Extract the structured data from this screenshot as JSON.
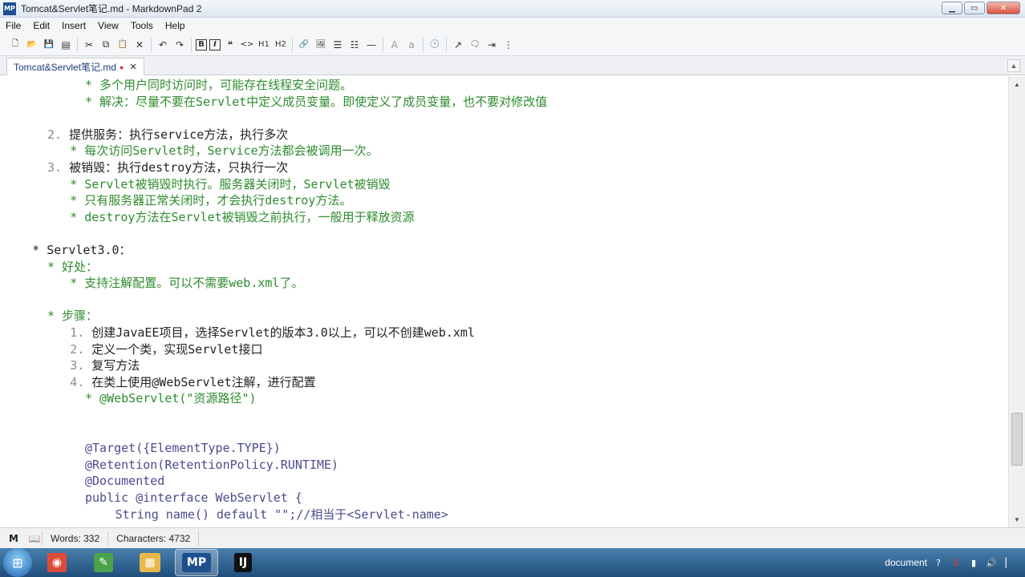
{
  "window": {
    "title": "Tomcat&Servlet笔记.md - MarkdownPad 2",
    "icon": "MP"
  },
  "window_controls": {
    "minimize": "▁",
    "maximize": "▭",
    "close": "✕"
  },
  "menu": [
    "File",
    "Edit",
    "Insert",
    "View",
    "Tools",
    "Help"
  ],
  "toolbar": {
    "icons": [
      {
        "name": "new-icon",
        "glyph": "🗋"
      },
      {
        "name": "open-icon",
        "glyph": "📂"
      },
      {
        "name": "save-icon",
        "glyph": "💾"
      },
      {
        "name": "save-all-icon",
        "glyph": "▤"
      },
      {
        "name": "cut-icon",
        "glyph": "✂"
      },
      {
        "name": "copy-icon",
        "glyph": "⧉"
      },
      {
        "name": "paste-icon",
        "glyph": "📋"
      },
      {
        "name": "delete-icon",
        "glyph": "✕"
      },
      {
        "name": "undo-icon",
        "glyph": "↶"
      },
      {
        "name": "redo-icon",
        "glyph": "↷"
      },
      {
        "name": "bold-icon",
        "glyph": "B"
      },
      {
        "name": "italic-icon",
        "glyph": "I"
      },
      {
        "name": "quote-icon",
        "glyph": "❝"
      },
      {
        "name": "code-icon",
        "glyph": "<>"
      },
      {
        "name": "h1-icon",
        "glyph": "H1"
      },
      {
        "name": "h2-icon",
        "glyph": "H2"
      },
      {
        "name": "link-icon",
        "glyph": "🔗"
      },
      {
        "name": "image-icon",
        "glyph": "🖼"
      },
      {
        "name": "unordered-list-icon",
        "glyph": "☰"
      },
      {
        "name": "ordered-list-icon",
        "glyph": "☷"
      },
      {
        "name": "horizontal-rule-icon",
        "glyph": "—"
      },
      {
        "name": "uppercase-icon",
        "glyph": "A"
      },
      {
        "name": "lowercase-icon",
        "glyph": "a"
      },
      {
        "name": "timestamp-icon",
        "glyph": "🕒"
      },
      {
        "name": "preview-icon",
        "glyph": "↗"
      },
      {
        "name": "preview-side-icon",
        "glyph": "🗨"
      },
      {
        "name": "export-icon",
        "glyph": "⇥"
      },
      {
        "name": "more-icon",
        "glyph": "⋮"
      }
    ]
  },
  "tab": {
    "label": "Tomcat&Servlet笔记.md",
    "modified": "●",
    "close": "✕"
  },
  "editor": {
    "lines": [
      {
        "indent": 10,
        "text": "* 多个用户同时访问时，可能存在线程安全问题。",
        "cls": "green"
      },
      {
        "indent": 10,
        "text": "* 解决：尽量不要在Servlet中定义成员变量。即使定义了成员变量，也不要对修改值",
        "cls": "green"
      },
      {
        "indent": 0,
        "text": "",
        "cls": ""
      },
      {
        "indent": 5,
        "text": "2. 提供服务：执行service方法，执行多次",
        "cls": "num"
      },
      {
        "indent": 8,
        "text": "* 每次访问Servlet时，Service方法都会被调用一次。",
        "cls": "green"
      },
      {
        "indent": 5,
        "text": "3. 被销毁：执行destroy方法，只执行一次",
        "cls": "num"
      },
      {
        "indent": 8,
        "text": "* Servlet被销毁时执行。服务器关闭时，Servlet被销毁",
        "cls": "green"
      },
      {
        "indent": 8,
        "text": "* 只有服务器正常关闭时，才会执行destroy方法。",
        "cls": "green"
      },
      {
        "indent": 8,
        "text": "* destroy方法在Servlet被销毁之前执行，一般用于释放资源",
        "cls": "green"
      },
      {
        "indent": 0,
        "text": "",
        "cls": ""
      },
      {
        "indent": 3,
        "text": "* Servlet3.0：",
        "cls": ""
      },
      {
        "indent": 5,
        "text": "* 好处：",
        "cls": "green"
      },
      {
        "indent": 8,
        "text": "* 支持注解配置。可以不需要web.xml了。",
        "cls": "green"
      },
      {
        "indent": 0,
        "text": "",
        "cls": ""
      },
      {
        "indent": 5,
        "text": "* 步骤：",
        "cls": "green"
      },
      {
        "indent": 8,
        "text": "1. 创建JavaEE项目，选择Servlet的版本3.0以上，可以不创建web.xml",
        "cls": "num"
      },
      {
        "indent": 8,
        "text": "2. 定义一个类，实现Servlet接口",
        "cls": "num"
      },
      {
        "indent": 8,
        "text": "3. 复写方法",
        "cls": "num"
      },
      {
        "indent": 8,
        "text": "4. 在类上使用@WebServlet注解，进行配置",
        "cls": "num"
      },
      {
        "indent": 10,
        "text": "* @WebServlet(\"资源路径\")",
        "cls": "green"
      },
      {
        "indent": 0,
        "text": "",
        "cls": ""
      },
      {
        "indent": 0,
        "text": "",
        "cls": ""
      },
      {
        "indent": 10,
        "text": "@Target({ElementType.TYPE})",
        "cls": "code"
      },
      {
        "indent": 10,
        "text": "@Retention(RetentionPolicy.RUNTIME)",
        "cls": "code"
      },
      {
        "indent": 10,
        "text": "@Documented",
        "cls": "code"
      },
      {
        "indent": 10,
        "text": "public @interface WebServlet {",
        "cls": "code"
      },
      {
        "indent": 14,
        "text": "String name() default \"\";//相当于<Servlet-name>",
        "cls": "code"
      }
    ]
  },
  "statusbar": {
    "markdown_icon": "M",
    "book_icon": "📖",
    "words": "Words: 332",
    "characters": "Characters: 4732"
  },
  "taskbar": {
    "start": "⊞",
    "apps": [
      {
        "name": "chrome-task",
        "glyph": "◉",
        "color": "#dd4b39"
      },
      {
        "name": "editor-task",
        "glyph": "✎",
        "color": "#4aa34a"
      },
      {
        "name": "explorer-task",
        "glyph": "▦",
        "color": "#e8b84a"
      },
      {
        "name": "markdownpad-task",
        "glyph": "MP",
        "color": "#1e4f8f"
      },
      {
        "name": "intellij-task",
        "glyph": "IJ",
        "color": "#111"
      }
    ],
    "tray_text": "document"
  },
  "colors": {
    "accent": "#1e4f8f",
    "list_green": "#2e8b2e",
    "code": "#4b4b8f"
  }
}
